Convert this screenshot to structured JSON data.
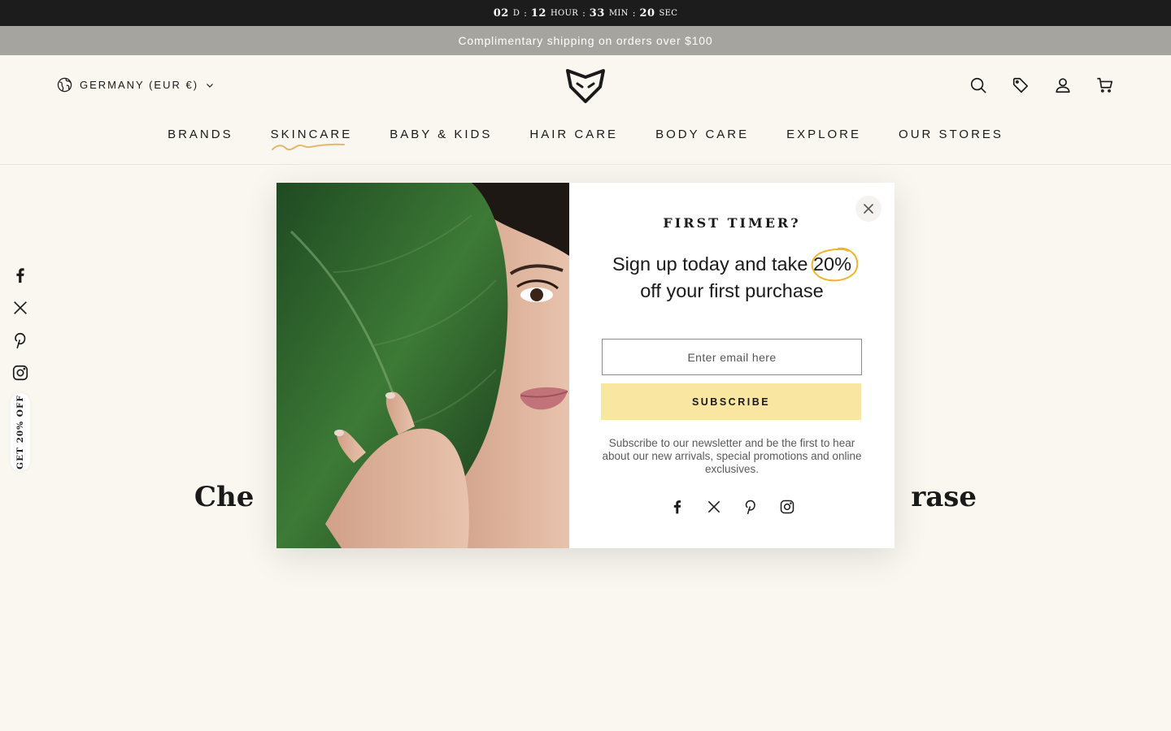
{
  "countdown": {
    "days": "02",
    "days_unit": "D",
    "hours": "12",
    "hours_unit": "HOUR",
    "minutes": "33",
    "minutes_unit": "MIN",
    "seconds": "20",
    "seconds_unit": "SEC",
    "separator": ":"
  },
  "announcement": "Complimentary shipping on orders over $100",
  "header": {
    "country": "GERMANY (EUR €)",
    "icons": [
      "search-icon",
      "tag-icon",
      "account-icon",
      "cart-icon"
    ]
  },
  "nav": {
    "items": [
      "BRANDS",
      "SKINCARE",
      "BABY & KIDS",
      "HAIR CARE",
      "BODY CARE",
      "EXPLORE",
      "OUR STORES"
    ],
    "active_index": 1,
    "accent_color": "#e3b86b"
  },
  "sidebar": {
    "social_icons": [
      "facebook-icon",
      "x-icon",
      "pinterest-icon",
      "instagram-icon"
    ],
    "promo_tab": "GET 20% OFF"
  },
  "page": {
    "heading_left": "Che",
    "heading_right": "rase"
  },
  "popup": {
    "eyebrow": "FIRST TIMER?",
    "pitch_before": "Sign up today and take ",
    "pitch_highlight": "20%",
    "pitch_after": "off your first purchase",
    "email_placeholder": "Enter email here",
    "email_value": "",
    "subscribe_label": "SUBSCRIBE",
    "fine_print": "Subscribe to our newsletter and be the first to hear about our new arrivals, special promotions and online exclusives.",
    "social_icons": [
      "facebook-icon",
      "x-icon",
      "pinterest-icon",
      "instagram-icon"
    ],
    "highlight_color": "#f0b429",
    "button_color": "#f9e7a1"
  }
}
